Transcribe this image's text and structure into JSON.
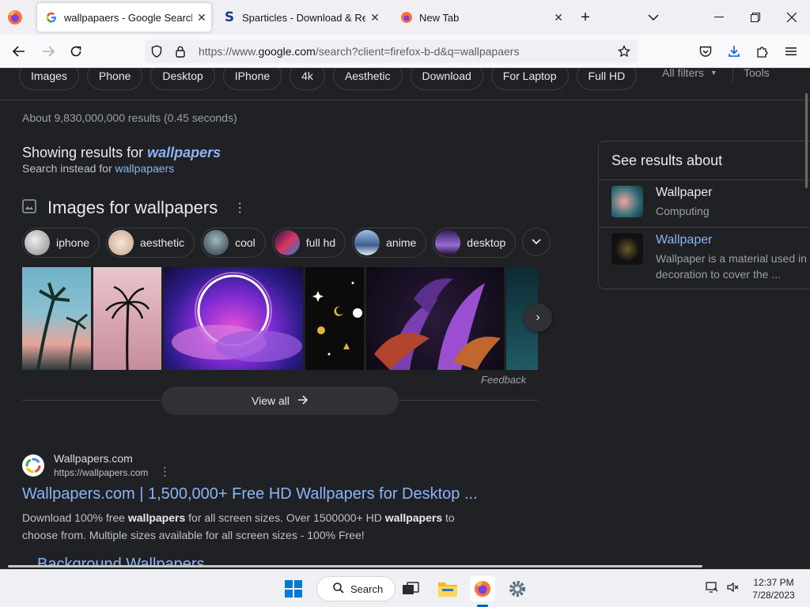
{
  "browser": {
    "tabs": [
      {
        "title": "wallpapaers - Google Search",
        "active": true
      },
      {
        "title": "Sparticles - Download & Review",
        "active": false
      },
      {
        "title": "New Tab",
        "active": false
      }
    ],
    "url": {
      "prefix": "https://www.",
      "domain": "google.com",
      "rest": "/search?client=firefox-b-d&q=wallpapaers"
    }
  },
  "google": {
    "filter_chips": [
      "Images",
      "Phone",
      "Desktop",
      "IPhone",
      "4k",
      "Aesthetic",
      "Download",
      "For Laptop",
      "Full HD"
    ],
    "all_filters": "All filters",
    "tools": "Tools",
    "stats": "About 9,830,000,000 results (0.45 seconds)",
    "correction": {
      "showing_prefix": "Showing results for",
      "corrected": "wallpapers",
      "instead_prefix": "Search instead for",
      "original": "wallpapaers"
    },
    "images_block": {
      "title": "Images for wallpapers",
      "chips": [
        {
          "label": "iphone",
          "color": "#c9c9c9"
        },
        {
          "label": "aesthetic",
          "color": "#e9d2c2"
        },
        {
          "label": "cool",
          "color": "#3d5a6a"
        },
        {
          "label": "full hd",
          "color": "#3b2a6e"
        },
        {
          "label": "anime",
          "color": "#6f8fb5"
        },
        {
          "label": "desktop",
          "color": "#5a3b8c"
        }
      ],
      "feedback": "Feedback",
      "view_all": "View all"
    },
    "result": {
      "site_name": "Wallpapers.com",
      "site_url": "https://wallpapers.com",
      "title": "Wallpapers.com | 1,500,000+ Free HD Wallpapers for Desktop ...",
      "snippet_1": "Download 100% free ",
      "snippet_b1": "wallpapers",
      "snippet_2": " for all screen sizes. Over 1500000+ HD ",
      "snippet_b2": "wallpapers",
      "snippet_3": " to choose from. Multiple sizes available for all screen sizes - 100% Free!",
      "next_title": "Background Wallpapers"
    },
    "knowledge": {
      "title": "See results about",
      "items": [
        {
          "name": "Wallpaper",
          "sub": "Computing"
        },
        {
          "name": "Wallpaper",
          "sub_1": "Wallpaper is a material used in",
          "sub_2": "decoration to cover the ..."
        }
      ]
    }
  },
  "taskbar": {
    "search_label": "Search",
    "time": "12:37 PM",
    "date": "7/28/2023"
  },
  "colors": {
    "link": "#8ab4f8",
    "page_bg": "#202124",
    "accent": "#005fb8"
  }
}
